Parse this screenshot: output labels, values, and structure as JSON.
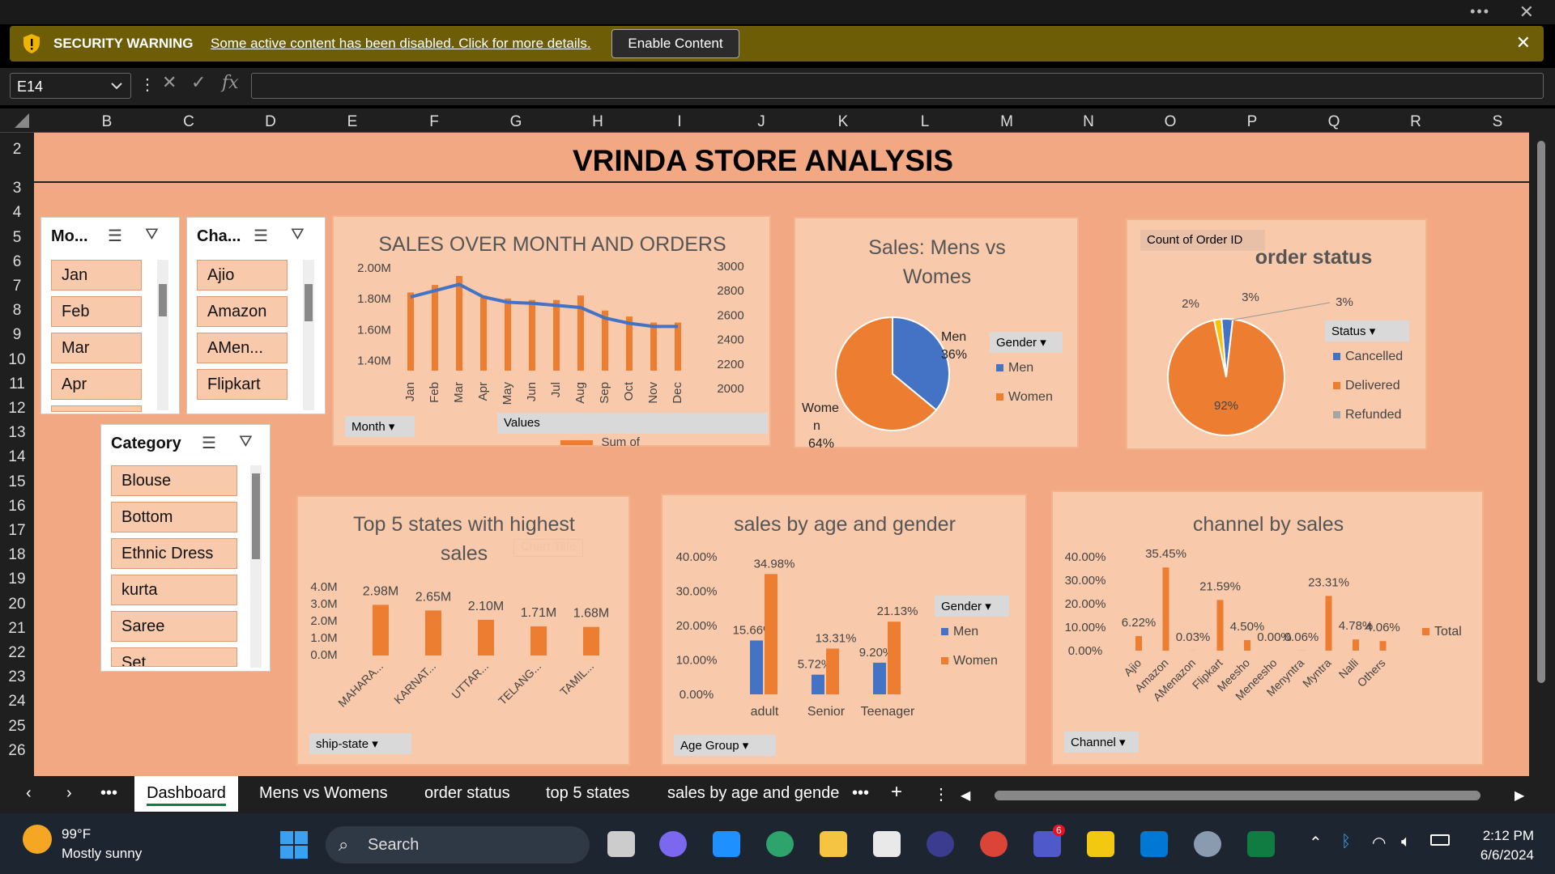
{
  "window": {
    "more": "•••",
    "close": "✕"
  },
  "security": {
    "label": "SECURITY WARNING",
    "message": "Some active content has been disabled. Click for more details.",
    "button": "Enable Content",
    "close": "✕"
  },
  "formula": {
    "cell": "E14",
    "value": ""
  },
  "columns": [
    "B",
    "C",
    "D",
    "E",
    "F",
    "G",
    "H",
    "I",
    "J",
    "K",
    "L",
    "M",
    "N",
    "O",
    "P",
    "Q",
    "R",
    "S"
  ],
  "rows": [
    "2",
    "3",
    "4",
    "5",
    "6",
    "7",
    "8",
    "9",
    "10",
    "11",
    "12",
    "13",
    "14",
    "15",
    "16",
    "17",
    "18",
    "19",
    "20",
    "21",
    "22",
    "23",
    "24",
    "25",
    "26"
  ],
  "dashboard": {
    "title": "VRINDA STORE ANALYSIS"
  },
  "slicers": {
    "month": {
      "title": "Mo...",
      "items": [
        "Jan",
        "Feb",
        "Mar",
        "Apr"
      ]
    },
    "channel": {
      "title": "Cha...",
      "items": [
        "Ajio",
        "Amazon",
        "AMen...",
        "Flipkart"
      ]
    },
    "category": {
      "title": "Category",
      "items": [
        "Blouse",
        "Bottom",
        "Ethnic Dress",
        "kurta",
        "Saree",
        "Set"
      ]
    }
  },
  "chart_data": [
    {
      "type": "bar",
      "title": "SALES OVER MONTH AND ORDERS",
      "categories": [
        "Jan",
        "Feb",
        "Mar",
        "Apr",
        "May",
        "Jun",
        "Jul",
        "Aug",
        "Sep",
        "Oct",
        "Nov",
        "Dec"
      ],
      "series": [
        {
          "name": "Sum of AMount",
          "values": [
            1.82,
            1.87,
            1.93,
            1.8,
            1.78,
            1.77,
            1.77,
            1.8,
            1.7,
            1.66,
            1.62,
            1.62
          ]
        },
        {
          "values": [
            2700,
            2760,
            2820,
            2700,
            2650,
            2640,
            2620,
            2600,
            2500,
            2450,
            2420,
            2420
          ]
        }
      ],
      "y_ticks": [
        "2.00M",
        "1.80M",
        "1.60M",
        "1.40M"
      ],
      "y2_ticks": [
        "3000",
        "2800",
        "2600",
        "2400",
        "2200",
        "2000"
      ],
      "filters": [
        "Month",
        "Values"
      ],
      "legend": "Sum of AMount",
      "legend_partial": "Sum of AMeount",
      "ylim": [
        1.3,
        2.0
      ],
      "y2lim": [
        2000,
        3000
      ]
    },
    {
      "type": "pie",
      "title_line1": "Sales: Mens vs",
      "title_line2": "Womes",
      "categories": [
        "Men",
        "Women"
      ],
      "values": [
        36,
        64
      ],
      "labels": {
        "men": "Men",
        "men_pct": "36%",
        "women_1": "Wome",
        "women_2": "n",
        "women_3": "64%"
      },
      "legend_title": "Gender",
      "colors": [
        "#4472c4",
        "#ed7d31"
      ]
    },
    {
      "type": "pie",
      "title": "order status",
      "field": "Count of Order ID",
      "categories": [
        "Cancelled",
        "Delivered",
        "Refunded"
      ],
      "values": [
        3,
        92,
        2
      ],
      "labels": [
        "3%",
        "92%",
        "2%",
        "3%"
      ],
      "legend_title": "Status"
    },
    {
      "type": "bar",
      "title_line1": "Top 5 states with highest",
      "title_line2": "sales",
      "ghost": "Chart Title",
      "categories": [
        "MAHARA...",
        "KARNAT...",
        "UTTAR...",
        "TELANG...",
        "TAMIL..."
      ],
      "values": [
        2.98,
        2.65,
        2.1,
        1.71,
        1.68
      ],
      "value_labels": [
        "2.98M",
        "2.65M",
        "2.10M",
        "1.71M",
        "1.68M"
      ],
      "y_ticks": [
        "4.0M",
        "3.0M",
        "2.0M",
        "1.0M",
        "0.0M"
      ],
      "filter": "ship-state",
      "ylim": [
        0,
        4
      ]
    },
    {
      "type": "bar",
      "title": "sales by age and gender",
      "categories": [
        "adult",
        "Senior",
        "Teenager"
      ],
      "series": [
        {
          "name": "Men",
          "values": [
            15.66,
            5.72,
            9.2
          ]
        },
        {
          "name": "Women",
          "values": [
            34.98,
            13.31,
            21.13
          ]
        }
      ],
      "value_labels": {
        "men": [
          "15.66%",
          "5.72%",
          "9.20%"
        ],
        "women": [
          "34.98%",
          "13.31%",
          "21.13%"
        ]
      },
      "y_ticks": [
        "40.00%",
        "30.00%",
        "20.00%",
        "10.00%",
        "0.00%"
      ],
      "legend_title": "Gender",
      "filter": "Age Group",
      "ylim": [
        0,
        40
      ]
    },
    {
      "type": "bar",
      "title": "channel by sales",
      "categories": [
        "Ajio",
        "Amazon",
        "AMenazon",
        "Flipkart",
        "Meesho",
        "Meneesho",
        "Menyntra",
        "Myntra",
        "Nalli",
        "Others"
      ],
      "values": [
        6.22,
        35.45,
        0.03,
        21.59,
        4.5,
        0.0,
        0.06,
        23.31,
        4.78,
        4.06
      ],
      "value_labels": [
        "6.22%",
        "35.45%",
        "0.03%",
        "21.59%",
        "4.50%",
        "0.00%",
        "0.06%",
        "23.31%",
        "4.78%",
        "4.06%"
      ],
      "y_ticks": [
        "40.00%",
        "30.00%",
        "20.00%",
        "10.00%",
        "0.00%"
      ],
      "legend": "Total",
      "filter": "Channel",
      "ylim": [
        0,
        40
      ]
    }
  ],
  "tabs": [
    "Dashboard",
    "Mens vs Womens",
    "order status",
    "top 5 states",
    "sales by age and gende"
  ],
  "taskbar": {
    "temp": "99°F",
    "cond": "Mostly sunny",
    "search": "Search",
    "time": "2:12 PM",
    "date": "6/6/2024",
    "badge": "6"
  }
}
